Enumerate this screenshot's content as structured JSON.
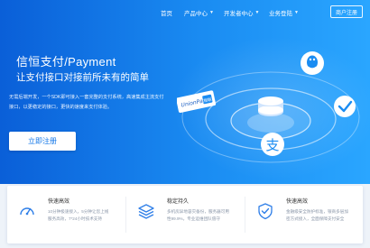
{
  "nav": {
    "items": [
      {
        "label": "首页",
        "has_dropdown": false
      },
      {
        "label": "产品中心",
        "has_dropdown": true
      },
      {
        "label": "开发者中心",
        "has_dropdown": true
      },
      {
        "label": "业务登陆",
        "has_dropdown": true
      }
    ],
    "register_label": "商户注册"
  },
  "hero": {
    "title": "信恒支付/Payment",
    "subtitle": "让支付接口对接前所未有的简单",
    "desc_line1": "无需后端开发，一个SDK即可接入一套完整的支付系统，高速集成主流支付",
    "desc_line2": "接口，以更稳定的接口，更快的速度来支付体验。",
    "cta_label": "立即注册",
    "illustration": {
      "unionpay_text": "UnionPay",
      "unionpay_cn": "银联",
      "alipay_glyph": "支",
      "icons": [
        "qq-icon",
        "wechat-check-icon",
        "alipay-icon",
        "unionpay-icon",
        "database-icon"
      ]
    }
  },
  "features": [
    {
      "icon": "speedometer-icon",
      "title": "快速高效",
      "desc_line1": "10分钟极速接入，5分钟让您上线",
      "desc_line2": "服务高效，7*24小时技术支持"
    },
    {
      "icon": "layers-icon",
      "title": "稳定持久",
      "desc_line1": "多机房异地容灾备份，服务器可用",
      "desc_line2": "性99.9%，专业运维团队值守"
    },
    {
      "icon": "shield-check-icon",
      "title": "快速高效",
      "desc_line1": "金融级安全防护标准，银商多层加",
      "desc_line2": "密方式接入，全面保障支付安全"
    }
  ],
  "colors": {
    "hero_start": "#0a5fd8",
    "hero_end": "#2aa6ff",
    "cta_text": "#1377e8",
    "icon_stroke": "#2f7fe8"
  }
}
